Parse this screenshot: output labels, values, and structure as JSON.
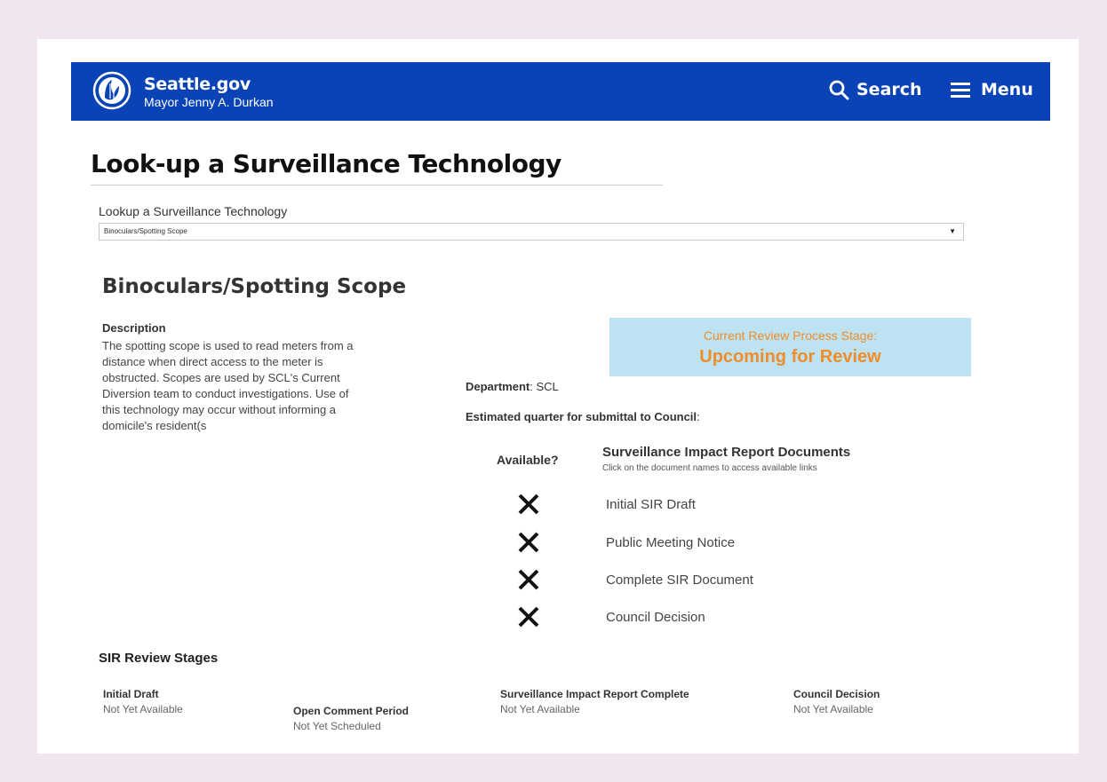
{
  "header": {
    "brand_title": "Seattle.gov",
    "brand_subtitle": "Mayor Jenny A. Durkan",
    "search_label": "Search",
    "menu_label": "Menu",
    "bar_color": "#0a43b5"
  },
  "page": {
    "title": "Look-up a Surveillance Technology"
  },
  "lookup": {
    "label": "Lookup a Surveillance Technology",
    "selected_value": "Binoculars/Spotting Scope"
  },
  "technology": {
    "name": "Binoculars/Spotting Scope",
    "description_heading": "Description",
    "description": "The spotting scope is used to read meters from a distance when direct access to the meter is obstructed.  Scopes are used by SCL's Current Diversion team to conduct investigations. Use of this technology may occur without informing a domicile's resident(s",
    "stage_label": "Current Review Process Stage:",
    "stage_value": "Upcoming for Review",
    "stage_color": "#f08c2a",
    "stage_bg": "#bde3f2",
    "department_label": "Department",
    "department_value": ": SCL",
    "quarter_label": "Estimated quarter for submittal to Council",
    "quarter_value": ":"
  },
  "documents": {
    "available_header": "Available?",
    "header": "Surveillance Impact Report Documents",
    "subheader": "Click on the document names to access available links",
    "items": [
      {
        "name": "Initial SIR Draft",
        "available": false
      },
      {
        "name": "Public Meeting Notice",
        "available": false
      },
      {
        "name": "Complete SIR Document",
        "available": false
      },
      {
        "name": "Council Decision",
        "available": false
      }
    ]
  },
  "review_stages": {
    "heading": "SIR Review Stages",
    "stages": [
      {
        "title": "Initial Draft",
        "status": "Not Yet Available"
      },
      {
        "title": "Open Comment Period",
        "status": "Not Yet Scheduled"
      },
      {
        "title": "Surveillance Impact Report Complete",
        "status": "Not Yet Available"
      },
      {
        "title": "Council Decision",
        "status": "Not Yet Available"
      }
    ]
  }
}
